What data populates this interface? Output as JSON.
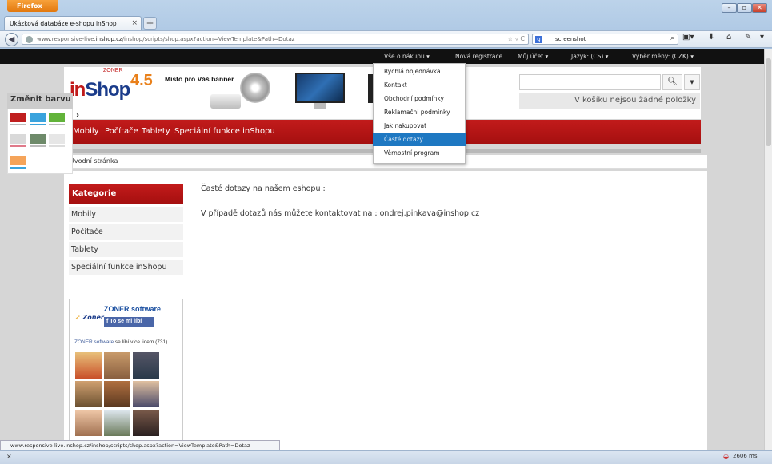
{
  "browser": {
    "menu_button": "Firefox",
    "tab_title": "Ukázková databáze e-shopu inShop",
    "url_prefix": "www.responsive-live.",
    "url_domain": "inshop.cz",
    "url_path": "/inshop/scripts/shop.aspx?action=ViewTemplate&Path=Dotaz",
    "search_value": "screenshot",
    "status_url": "www.responsive-live.inshop.cz/inshop/scripts/shop.aspx?action=ViewTemplate&Path=Dotaz",
    "load_time": "2606 ms"
  },
  "topnav": {
    "items": [
      "Vše o nákupu ▾",
      "Nová registrace",
      "Můj účet ▾",
      "Jazyk: (CS) ▾",
      "Výběr měny: (CZK) ▾"
    ]
  },
  "dropdown": {
    "items": [
      "Rychlá objednávka",
      "Kontakt",
      "Obchodní podmínky",
      "Reklamační podmínky",
      "Jak nakupovat",
      "Časté dotazy",
      "Věrnostní program"
    ],
    "selected_index": 5
  },
  "header": {
    "logo_in": "in",
    "logo_shop": "Shop",
    "logo_version": "4.5",
    "logo_zoner": "ZONER",
    "banner_text": "Místo pro Váš banner",
    "cart_text": "V košíku nejsou žádné položky"
  },
  "mainmenu": [
    "Mobily",
    "Počítače",
    "Tablety",
    "Speciální funkce inShopu"
  ],
  "breadcrumb": "Úvodní stránka",
  "sidebar": {
    "title": "Kategorie",
    "items": [
      "Mobily",
      "Počítače",
      "Tablety",
      "Speciální funkce inShopu"
    ]
  },
  "facebook": {
    "company": "ZONER software",
    "logo_text": "Zoner",
    "like_button": "To se mi líbí",
    "likes_link": "ZONER software",
    "likes_text": " se líbí více lidem (731)."
  },
  "content": {
    "heading": "Časté dotazy na našem eshopu :",
    "contact_prefix": "V případě  dotazů nás můžete kontaktovat na :  ",
    "email": "ondrej.pinkava@inshop.cz"
  },
  "colorpanel": {
    "title": "Změnit barvu",
    "swatches": [
      "#c01f1f",
      "#3aa3dd",
      "#62b33a",
      "#d9d9d9",
      "#6e8a6a",
      "#e6e6e6",
      "#f5a45a"
    ]
  }
}
